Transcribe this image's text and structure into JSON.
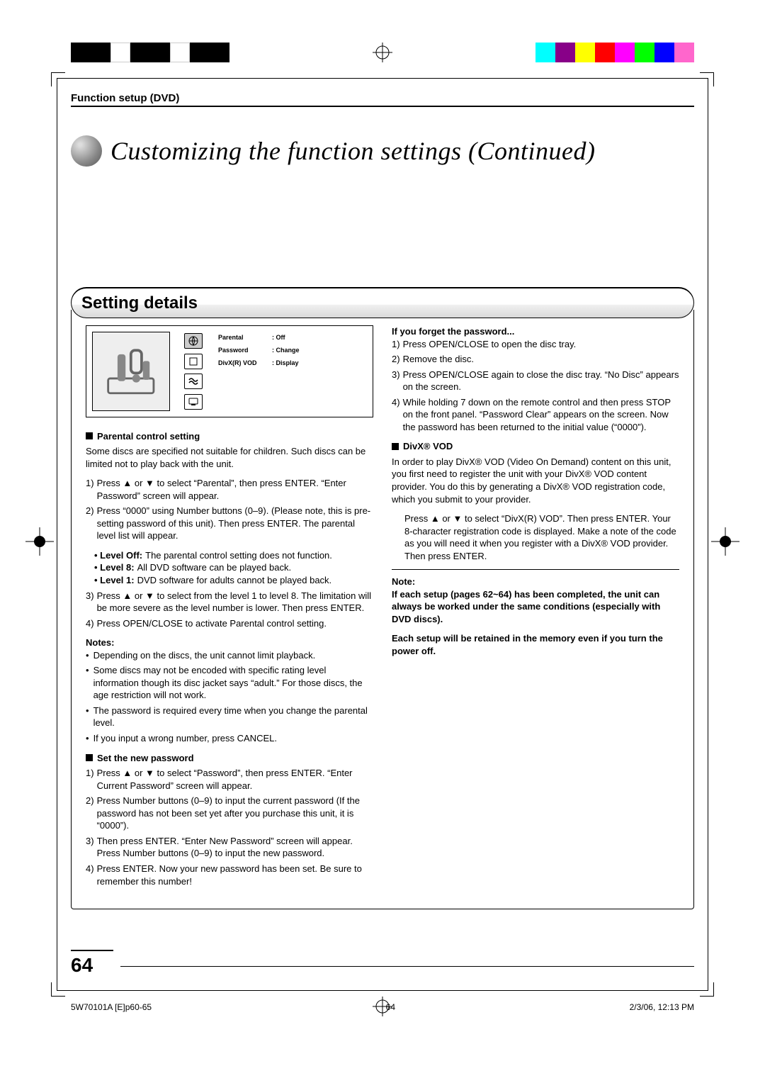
{
  "header": {
    "section_label": "Function setup (DVD)"
  },
  "title": "Customizing the function settings (Continued)",
  "heading": "Setting details",
  "menu": {
    "items": [
      {
        "key": "Parental",
        "val": ": Off"
      },
      {
        "key": "Password",
        "val": ": Change"
      },
      {
        "key": "DivX(R) VOD",
        "val": ": Display"
      }
    ]
  },
  "left": {
    "h_parental": "Parental control setting",
    "parental_intro": "Some discs are specified not suitable for children. Such discs can be limited not to play back with the unit.",
    "parental_steps": [
      {
        "n": "1)",
        "t": "Press ▲ or ▼ to select “Parental”, then press ENTER. “Enter Password” screen will appear."
      },
      {
        "n": "2)",
        "t": "Press “0000” using Number buttons (0–9). (Please note, this is pre-setting password of this unit). Then press ENTER. The parental level list will appear."
      }
    ],
    "levels": [
      {
        "lvl": "• Level Off:",
        "d": "The parental control setting does not function."
      },
      {
        "lvl": "• Level 8:",
        "d": "All DVD software can be played back."
      },
      {
        "lvl": "• Level 1:",
        "d": "DVD software for adults cannot be played back."
      }
    ],
    "parental_steps_b": [
      {
        "n": "3)",
        "t": "Press ▲ or ▼ to select from the level 1 to level 8. The limitation will be more severe as the level number is lower. Then press ENTER."
      },
      {
        "n": "4)",
        "t": "Press OPEN/CLOSE to activate Parental control setting."
      }
    ],
    "notes_label": "Notes:",
    "notes": [
      "Depending on the discs, the unit cannot limit playback.",
      "Some discs may not be encoded with specific rating level information though its disc jacket says “adult.” For those discs, the age restriction will not work.",
      "The password is required every time when you change the parental level.",
      "If you input a wrong number, press CANCEL."
    ],
    "h_password": "Set the new password",
    "password_steps": [
      {
        "n": "1)",
        "t": "Press ▲ or ▼ to select “Password”, then press ENTER. “Enter Current Password” screen will appear."
      },
      {
        "n": "2)",
        "t": "Press Number buttons (0–9) to input the current password (If the password has not been set yet after you purchase this unit, it is “0000”)."
      },
      {
        "n": "3)",
        "t": "Then press ENTER. “Enter New Password” screen will appear. Press Number buttons (0–9) to input the new password."
      },
      {
        "n": "4)",
        "t": "Press ENTER. Now your new password has been set. Be sure to remember this number!"
      }
    ]
  },
  "right": {
    "h_forget": "If you forget the password...",
    "forget_steps": [
      {
        "n": "1)",
        "t": "Press OPEN/CLOSE to open the disc tray."
      },
      {
        "n": "2)",
        "t": "Remove the disc."
      },
      {
        "n": "3)",
        "t": "Press OPEN/CLOSE again to close the disc tray. “No Disc” appears on the screen."
      },
      {
        "n": "4)",
        "t": "While holding 7 down on the remote control and then press STOP on the front panel. “Password Clear” appears on the screen. Now the password has been returned to the initial value (“0000”)."
      }
    ],
    "h_divx": "DivX® VOD",
    "divx_p1": "In order to play DivX® VOD (Video On Demand) content on this unit, you first need to register the unit with your DivX® VOD content provider. You do this by generating a DivX® VOD registration code, which you submit to your provider.",
    "divx_p2": "Press ▲ or ▼ to select “DivX(R) VOD”. Then press ENTER. Your 8-character registration code is displayed. Make a note of the code as you will need it when you register with a DivX® VOD provider. Then press ENTER.",
    "note_label": "Note:",
    "note_body1": "If each setup (pages 62~64) has been completed, the unit can always be worked under the same conditions (especially with DVD discs).",
    "note_body2": "Each setup will be retained in the memory even if you turn the power off."
  },
  "page_number": "64",
  "footer": {
    "left": "5W70101A [E]p60-65",
    "center": "64",
    "right": "2/3/06, 12:13 PM"
  }
}
